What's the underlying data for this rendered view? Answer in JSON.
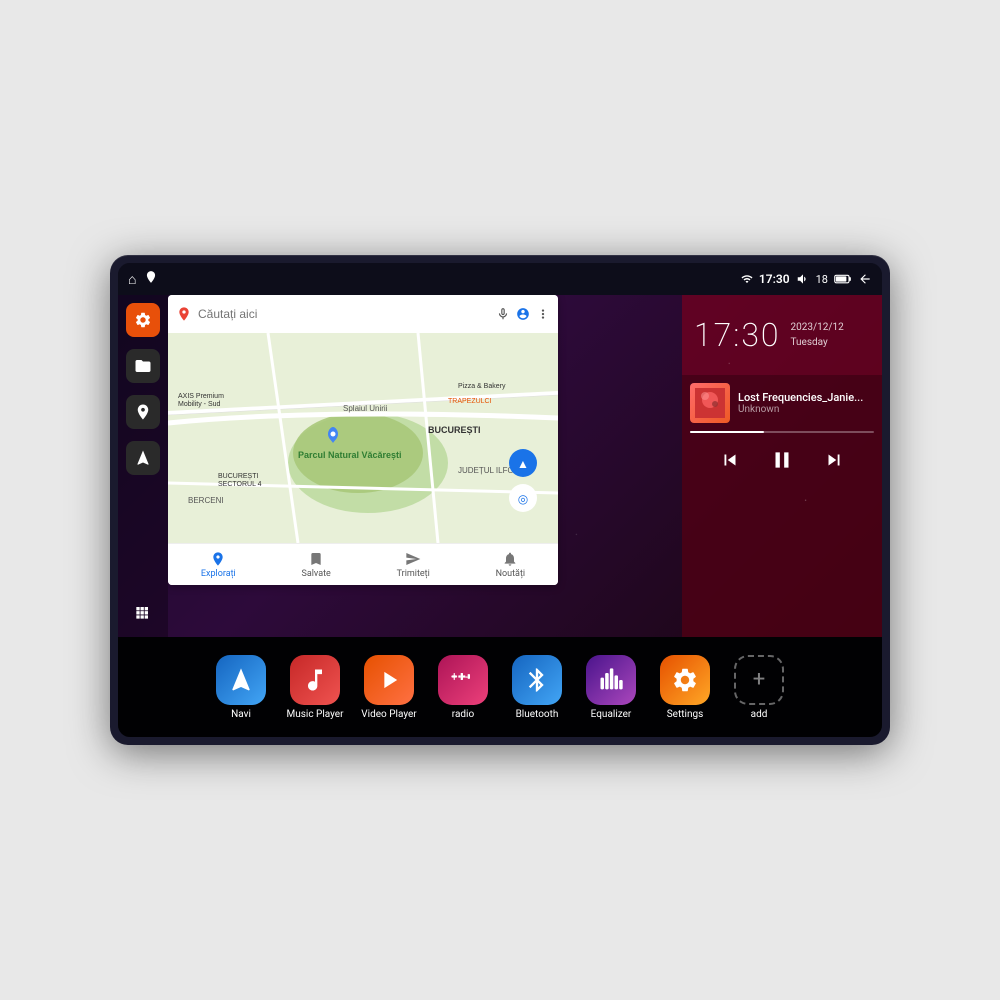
{
  "device": {
    "status_bar": {
      "left_icons": [
        "home",
        "location"
      ],
      "right_icons": [
        "wifi",
        "time",
        "volume",
        "battery_level",
        "battery",
        "back"
      ],
      "time": "17:30",
      "battery_level": "18"
    },
    "sidebar": {
      "buttons": [
        {
          "id": "settings",
          "icon": "⚙",
          "color": "orange"
        },
        {
          "id": "files",
          "icon": "▬",
          "color": "dark"
        },
        {
          "id": "map",
          "icon": "📍",
          "color": "dark"
        },
        {
          "id": "navi",
          "icon": "▲",
          "color": "dark"
        },
        {
          "id": "grid",
          "icon": "⋮⋮",
          "color": "grid"
        }
      ]
    },
    "map": {
      "search_placeholder": "Căutați aici",
      "locations": [
        "AXIS Premium Mobility - Sud",
        "Pizza & Bakery",
        "Parcul Natural Văcărești",
        "BUCUREȘTI",
        "BUCUREȘTI SECTORUL 4",
        "JUDEȚUL ILFOV",
        "BERCENI"
      ],
      "bottom_tabs": [
        {
          "label": "Explorați",
          "icon": "🔍",
          "active": true
        },
        {
          "label": "Salvate",
          "icon": "🔖",
          "active": false
        },
        {
          "label": "Trimiteți",
          "icon": "📤",
          "active": false
        },
        {
          "label": "Noutăți",
          "icon": "🔔",
          "active": false
        }
      ]
    },
    "clock": {
      "time": "17:30",
      "date": "2023/12/12",
      "day": "Tuesday"
    },
    "music": {
      "title": "Lost Frequencies_Janie...",
      "artist": "Unknown",
      "progress": 40,
      "controls": [
        "prev",
        "pause",
        "next"
      ]
    },
    "apps": [
      {
        "id": "navi",
        "label": "Navi",
        "icon": "▲",
        "class": "icon-navi"
      },
      {
        "id": "music-player",
        "label": "Music Player",
        "icon": "♪",
        "class": "icon-music"
      },
      {
        "id": "video-player",
        "label": "Video Player",
        "icon": "▶",
        "class": "icon-video"
      },
      {
        "id": "radio",
        "label": "radio",
        "icon": "📻",
        "class": "icon-radio"
      },
      {
        "id": "bluetooth",
        "label": "Bluetooth",
        "icon": "⚡",
        "class": "icon-bt"
      },
      {
        "id": "equalizer",
        "label": "Equalizer",
        "icon": "🎚",
        "class": "icon-eq"
      },
      {
        "id": "settings",
        "label": "Settings",
        "icon": "⚙",
        "class": "icon-settings"
      },
      {
        "id": "add",
        "label": "add",
        "icon": "+",
        "class": "icon-add"
      }
    ]
  }
}
